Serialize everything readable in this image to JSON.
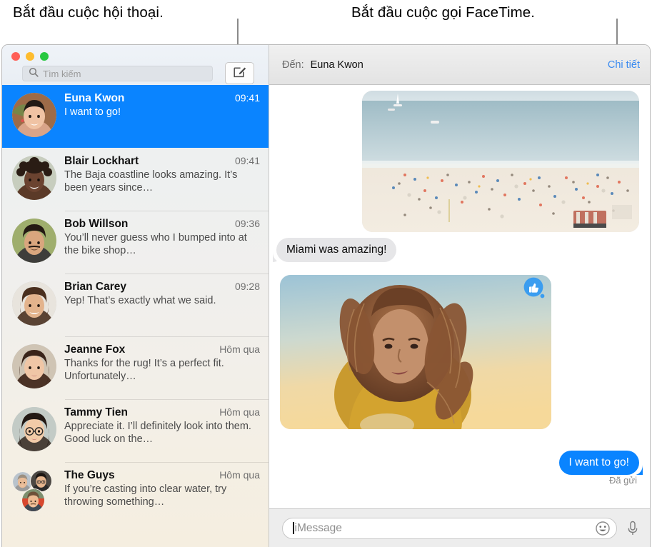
{
  "annotations": [
    {
      "text": "Bắt đầu cuộc hội thoại.",
      "target": "compose-button"
    },
    {
      "text": "Bắt đầu cuộc gọi FaceTime.",
      "target": "details-link"
    }
  ],
  "window": {
    "traffic_lights": [
      "close",
      "minimize",
      "zoom"
    ],
    "colors": {
      "accent_blue": "#0a84ff",
      "link_blue": "#3b8bf0",
      "received_bubble": "#e6e6e8",
      "close": "#ff5f57",
      "minimize": "#febc2e",
      "zoom": "#28c840"
    }
  },
  "sidebar": {
    "search": {
      "placeholder": "Tìm kiếm",
      "value": "",
      "icon": "search-icon"
    },
    "compose": {
      "icon": "compose-icon",
      "label": ""
    },
    "conversations": [
      {
        "name": "Euna Kwon",
        "time": "09:41",
        "preview": "I want to go!",
        "selected": true,
        "avatar": "euna"
      },
      {
        "name": "Blair Lockhart",
        "time": "09:41",
        "preview": "The Baja coastline looks amazing. It’s been years since…",
        "selected": false,
        "avatar": "blair"
      },
      {
        "name": "Bob Willson",
        "time": "09:36",
        "preview": "You’ll never guess who I bumped into at the bike shop…",
        "selected": false,
        "avatar": "bob"
      },
      {
        "name": "Brian Carey",
        "time": "09:28",
        "preview": "Yep! That’s exactly what we said.",
        "selected": false,
        "avatar": "brian"
      },
      {
        "name": "Jeanne Fox",
        "time": "Hôm qua",
        "preview": "Thanks for the rug! It’s a perfect fit. Unfortunately…",
        "selected": false,
        "avatar": "jeanne"
      },
      {
        "name": "Tammy Tien",
        "time": "Hôm qua",
        "preview": "Appreciate it. I’ll definitely look into them. Good luck on the…",
        "selected": false,
        "avatar": "tammy"
      },
      {
        "name": "The Guys",
        "time": "Hôm qua",
        "preview": "If you’re casting into clear water, try throwing something…",
        "selected": false,
        "avatar": "group"
      }
    ]
  },
  "thread": {
    "to_label": "Đến:",
    "recipient": "Euna Kwon",
    "details_link": "Chi tiết",
    "messages": [
      {
        "type": "photo",
        "side": "received",
        "description": "crowded-beach-photo"
      },
      {
        "type": "text",
        "side": "received",
        "text": "Miami was amazing!"
      },
      {
        "type": "photo",
        "side": "received",
        "description": "woman-portrait-sunset-photo",
        "reaction": "thumbs-up"
      },
      {
        "type": "text",
        "side": "sent",
        "text": "I want to go!",
        "status": "Đã gửi"
      }
    ]
  },
  "input_bar": {
    "placeholder": "iMessage",
    "value": "",
    "emoji_icon": "smiley-icon",
    "mic_icon": "microphone-icon"
  }
}
